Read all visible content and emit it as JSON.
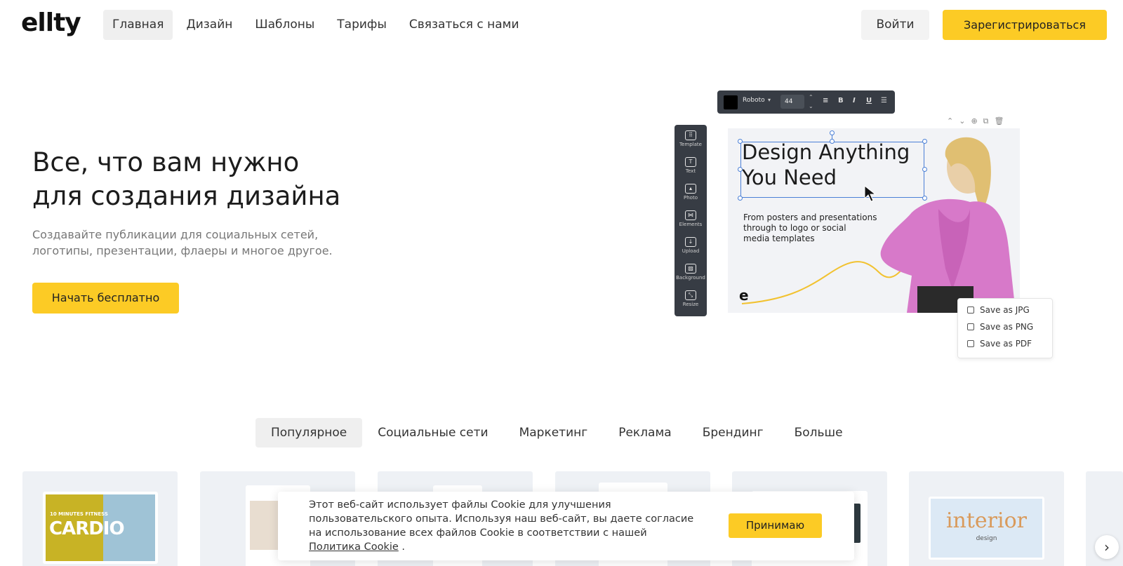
{
  "header": {
    "logo": "ellty",
    "nav": [
      "Главная",
      "Дизайн",
      "Шаблоны",
      "Тарифы",
      "Связаться с нами"
    ],
    "login_label": "Войти",
    "register_label": "Зарегистрироваться"
  },
  "hero": {
    "title_lines": [
      "Все, что вам нужно",
      "для создания дизайна"
    ],
    "subtitle_lines": [
      "Создавайте публикации для социальных сетей,",
      "логотипы, презентации, флаеры и многое другое."
    ],
    "cta_label": "Начать бесплатно"
  },
  "editor": {
    "toolbar": {
      "font": "Roboto",
      "size": "44",
      "bold": "B",
      "italic": "I",
      "underline": "U"
    },
    "tools": [
      {
        "label": "Template",
        "icon": "grid-icon"
      },
      {
        "label": "Text",
        "icon": "text-icon"
      },
      {
        "label": "Photo",
        "icon": "photo-icon"
      },
      {
        "label": "Elements",
        "icon": "elements-icon"
      },
      {
        "label": "Upload",
        "icon": "upload-icon"
      },
      {
        "label": "Background",
        "icon": "background-icon"
      },
      {
        "label": "Resize",
        "icon": "resize-icon"
      }
    ],
    "canvas_title_lines": [
      "Design Anything",
      "You Need"
    ],
    "canvas_text_lines": [
      "From posters and presentations",
      "through to logo or social",
      "media templates"
    ],
    "canvas_logo": "e",
    "save_menu": [
      "Save as JPG",
      "Save as PNG",
      "Save as PDF"
    ]
  },
  "categories": {
    "tabs": [
      "Популярное",
      "Социальные сети",
      "Маркетинг",
      "Реклама",
      "Брендинг",
      "Больше"
    ]
  },
  "cards": {
    "fitness_small": "10 MINUTES FITNESS",
    "fitness_big": "CARDIO",
    "interior_big": "interior",
    "interior_small": "design"
  },
  "cookie": {
    "text_lines": [
      "Этот веб-сайт использует файлы Cookie для улучшения",
      "пользовательского опыта. Используя наш веб-сайт, вы даете согласие",
      "на использование всех файлов Cookie в соответствии с нашей"
    ],
    "link_label": "Политика Cookie",
    "link_suffix": " .",
    "accept_label": "Принимаю"
  },
  "colors": {
    "accent": "#fccb25",
    "editor_dark": "#373c44",
    "selection": "#4a7fd6"
  }
}
